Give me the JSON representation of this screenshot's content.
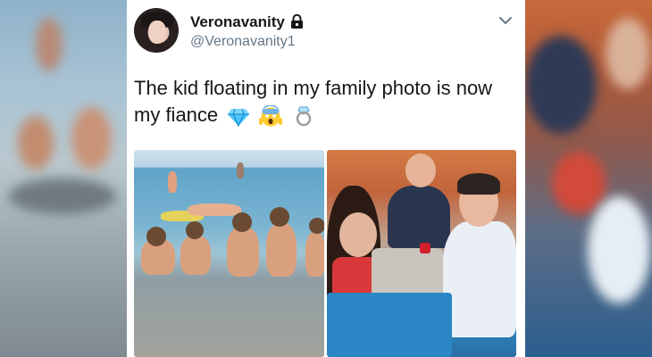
{
  "tweet": {
    "display_name": "Veronavanity",
    "handle": "@Veronavanity1",
    "text": "The kid floating in my family photo is now my fiance"
  },
  "icons": {
    "lock": "lock-icon",
    "chevron": "chevron-down-icon",
    "emojis": [
      "gem-icon",
      "screaming-face-icon",
      "ring-icon"
    ]
  },
  "colors": {
    "text_primary": "#14171a",
    "text_secondary": "#657786",
    "background": "#ffffff"
  }
}
